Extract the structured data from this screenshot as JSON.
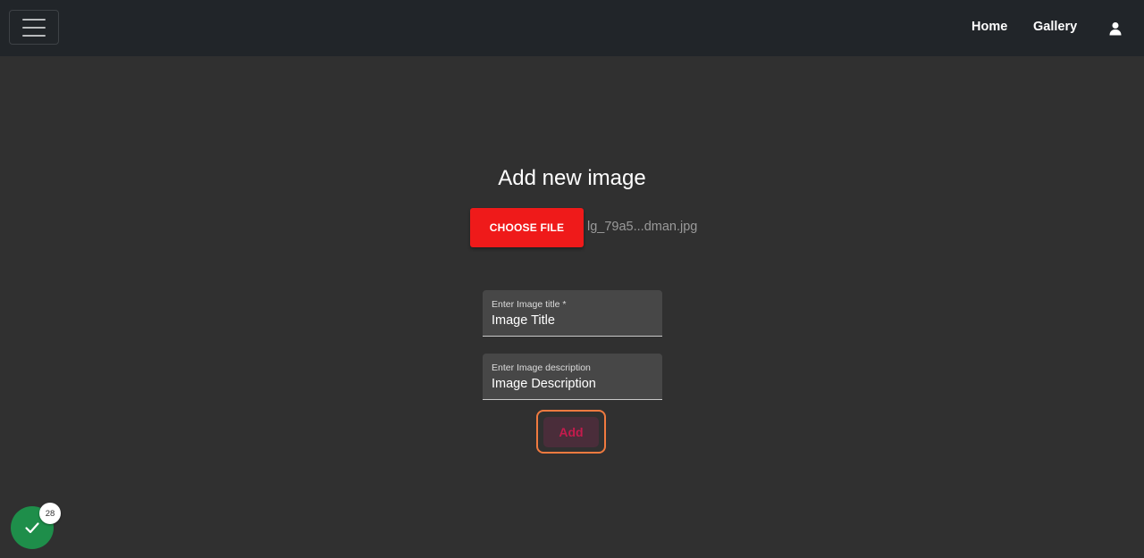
{
  "navbar": {
    "links": {
      "home": "Home",
      "gallery": "Gallery"
    },
    "toggler_icon": "hamburger-icon",
    "user_icon": "user-icon"
  },
  "form": {
    "title": "Add new image",
    "choose_file_label": "CHOOSE FILE",
    "file_name": "lg_79a5...dman.jpg",
    "title_field": {
      "label": "Enter Image title *",
      "value": "Image Title"
    },
    "description_field": {
      "label": "Enter Image description",
      "value": "Image Description"
    },
    "add_label": "Add"
  },
  "status_widget": {
    "icon": "check-icon",
    "badge_count": "28"
  },
  "colors": {
    "navbar_bg": "#212529",
    "page_bg": "#303030",
    "primary_red": "#ef1a1a",
    "focus_orange": "#f07a3f",
    "success_green": "#1e8e4a"
  }
}
